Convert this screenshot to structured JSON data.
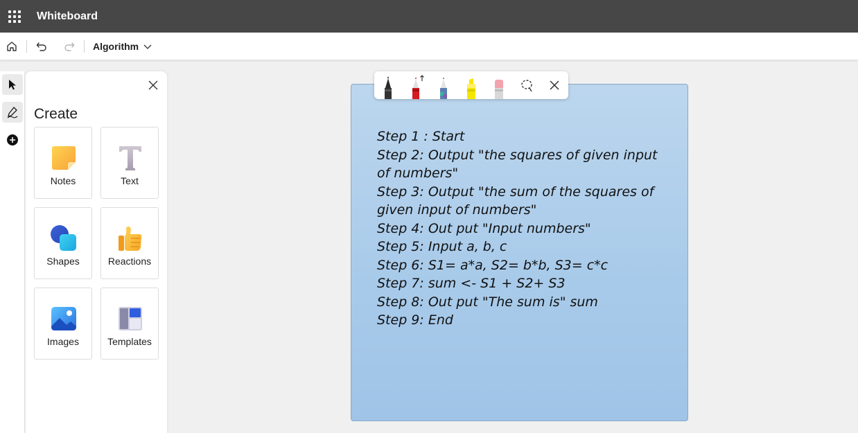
{
  "app": {
    "title": "Whiteboard"
  },
  "toolbar": {
    "board_name": "Algorithm"
  },
  "panel": {
    "title": "Create",
    "items": [
      {
        "label": "Notes",
        "icon": "sticky-note-icon"
      },
      {
        "label": "Text",
        "icon": "text-icon"
      },
      {
        "label": "Shapes",
        "icon": "shapes-icon"
      },
      {
        "label": "Reactions",
        "icon": "thumbs-up-icon"
      },
      {
        "label": "Images",
        "icon": "image-icon"
      },
      {
        "label": "Templates",
        "icon": "templates-icon"
      }
    ]
  },
  "inking_toolbar": {
    "tools": [
      "black-pen-icon",
      "red-pen-icon",
      "galaxy-pen-icon",
      "highlighter-icon",
      "eraser-icon",
      "lasso-select-icon",
      "close-icon"
    ]
  },
  "note": {
    "lines": [
      "Step 1 : Start",
      "Step 2: Output \"the squares of given input",
      "of numbers\"",
      "Step 3: Output \"the sum of the squares of",
      "given input of numbers\"",
      "Step 4: Out put \"Input numbers\"",
      "Step 5: Input a, b, c",
      "Step 6: S1= a*a, S2= b*b, S3= c*c",
      "Step 7: sum <- S1 + S2+ S3",
      "Step 8: Out put \"The sum is\" sum",
      "Step 9: End"
    ],
    "color": "#a9cbea"
  },
  "colors": {
    "titlebar": "#474747",
    "canvas": "#f0f0f0"
  }
}
